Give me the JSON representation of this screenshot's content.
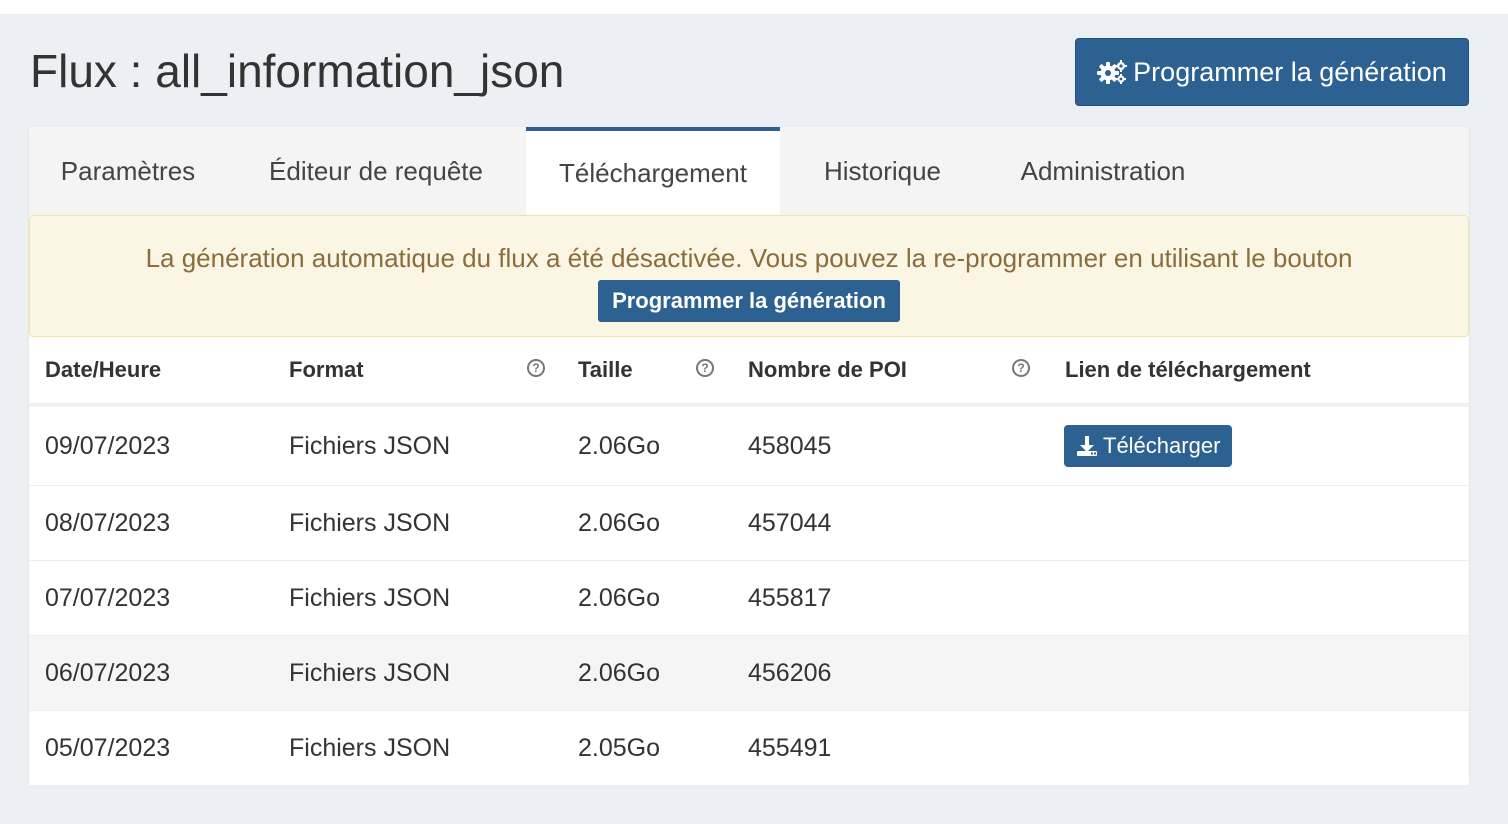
{
  "page": {
    "title": "Flux : all_information_json",
    "schedule_button": {
      "label": "Programmer la génération",
      "icon": "gears-icon"
    }
  },
  "tabs": [
    {
      "label": "Paramètres",
      "active": false
    },
    {
      "label": "Éditeur de requête",
      "active": false
    },
    {
      "label": "Téléchargement",
      "active": true
    },
    {
      "label": "Historique",
      "active": false
    },
    {
      "label": "Administration",
      "active": false
    }
  ],
  "alert": {
    "message": "La génération automatique du flux a été désactivée. Vous pouvez la re-programmer en utilisant le bouton",
    "button_label": "Programmer la génération"
  },
  "table": {
    "headers": {
      "date": "Date/Heure",
      "format": "Format",
      "size": "Taille",
      "poi": "Nombre de POI",
      "link": "Lien de téléchargement"
    },
    "help_icon": "question-circle-icon",
    "rows": [
      {
        "date": "09/07/2023",
        "format": "Fichiers JSON",
        "size": "2.06Go",
        "poi": "458045",
        "download_label": "Télécharger"
      },
      {
        "date": "08/07/2023",
        "format": "Fichiers JSON",
        "size": "2.06Go",
        "poi": "457044"
      },
      {
        "date": "07/07/2023",
        "format": "Fichiers JSON",
        "size": "2.06Go",
        "poi": "455817"
      },
      {
        "date": "06/07/2023",
        "format": "Fichiers JSON",
        "size": "2.06Go",
        "poi": "456206"
      },
      {
        "date": "05/07/2023",
        "format": "Fichiers JSON",
        "size": "2.05Go",
        "poi": "455491"
      }
    ]
  },
  "colors": {
    "primary": "#2c6191",
    "alert_background": "#fbf6e3",
    "alert_text": "#8a6d3b",
    "page_background": "#ecf0f5"
  }
}
